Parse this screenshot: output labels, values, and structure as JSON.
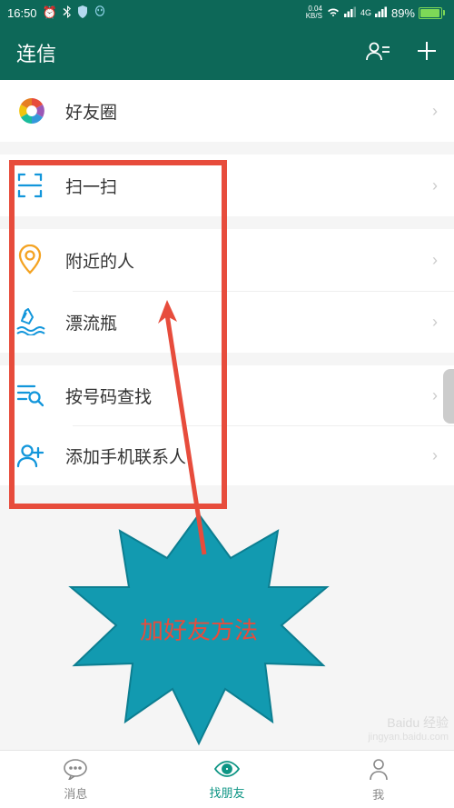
{
  "status": {
    "time": "16:50",
    "kbs_top": "0.04",
    "kbs_bot": "KB/S",
    "net": "4G",
    "battery_pct": "89%"
  },
  "header": {
    "title": "连信"
  },
  "groups": [
    [
      {
        "icon": "circle-multicolor",
        "label": "好友圈"
      }
    ],
    [
      {
        "icon": "scan",
        "label": "扫一扫"
      }
    ],
    [
      {
        "icon": "pin",
        "label": "附近的人"
      },
      {
        "icon": "bottle",
        "label": "漂流瓶"
      }
    ],
    [
      {
        "icon": "search-list",
        "label": "按号码查找"
      },
      {
        "icon": "add-contact",
        "label": "添加手机联系人"
      }
    ]
  ],
  "annotation": {
    "burst_text": "加好友方法"
  },
  "nav": {
    "items": [
      {
        "label": "消息"
      },
      {
        "label": "找朋友"
      },
      {
        "label": "我"
      }
    ]
  },
  "watermark": {
    "l1": "Baidu 经验",
    "l2": "jingyan.baidu.com"
  }
}
